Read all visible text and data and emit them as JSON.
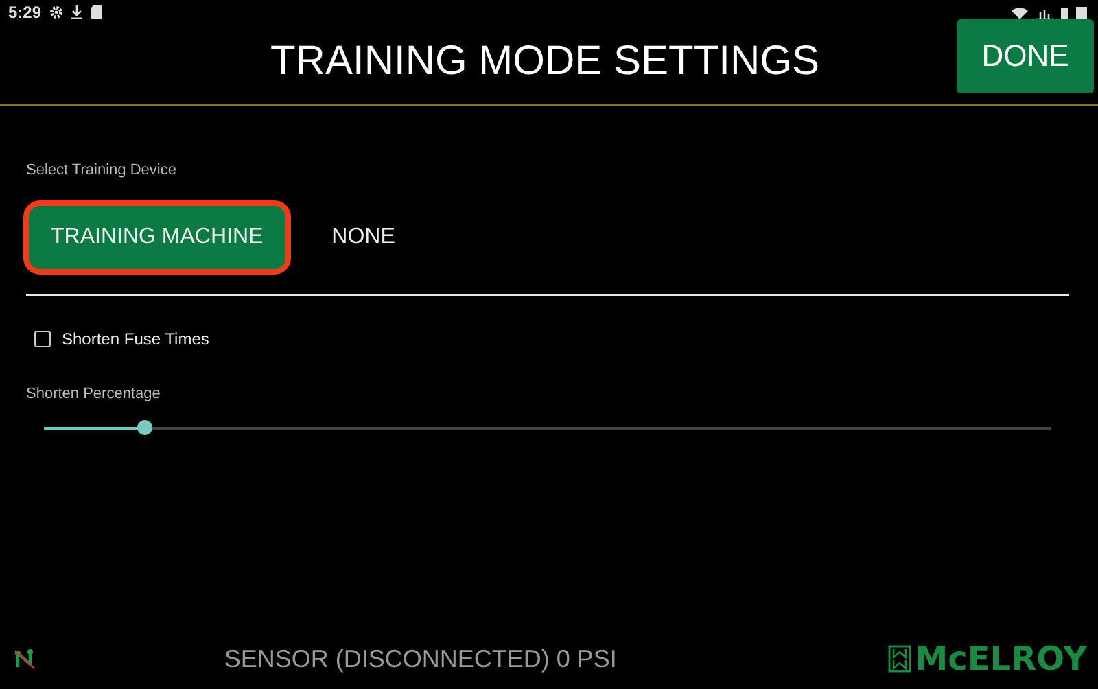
{
  "status_bar": {
    "time": "5:29"
  },
  "header": {
    "title": "TRAINING MODE SETTINGS",
    "done_button": "DONE"
  },
  "device": {
    "label": "Select Training Device",
    "options": [
      {
        "label": "TRAINING MACHINE",
        "selected": true
      },
      {
        "label": "NONE",
        "selected": false
      }
    ]
  },
  "shorten_fuse_times": {
    "label": "Shorten Fuse Times",
    "checked": false
  },
  "shorten_percentage": {
    "label": "Shorten Percentage",
    "level": 0.1
  },
  "footer": {
    "sensor": "SENSOR (DISCONNECTED)  0 PSI",
    "logo": "McELROY"
  }
}
